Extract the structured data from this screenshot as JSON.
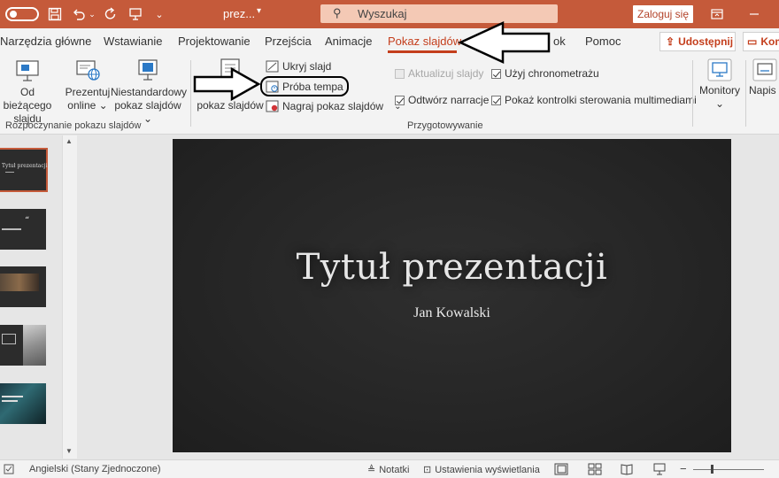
{
  "titlebar": {
    "document_name": "prez...",
    "search_placeholder": "Wyszukaj",
    "signin_label": "Zaloguj się"
  },
  "tabs": [
    {
      "label": "Narzędzia główne"
    },
    {
      "label": "Wstawianie"
    },
    {
      "label": "Projektowanie"
    },
    {
      "label": "Przejścia"
    },
    {
      "label": "Animacje"
    },
    {
      "label": "Pokaz slajdów",
      "active": true
    },
    {
      "label": "ok"
    },
    {
      "label": "Pomoc"
    }
  ],
  "share": {
    "label": "Udostępnij"
  },
  "comments": {
    "label": "Kom"
  },
  "ribbon": {
    "start_group": {
      "from_current": [
        "Od bieżącego",
        "slajdu"
      ],
      "online": [
        "Prezentuj",
        "online"
      ],
      "custom": [
        "Niestandardowy",
        "pokaz slajdów"
      ],
      "label": "Rozpoczynanie pokazu slajdów"
    },
    "setup_group": {
      "setup_show": "pokaz slajdów",
      "hide_slide": "Ukryj slajd",
      "rehearse": "Próba tempa",
      "record": "Nagraj pokaz slajdów",
      "update_slides": "Aktualizuj slajdy",
      "play_narrations": "Odtwórz narracje",
      "use_timings": "Użyj chronometrażu",
      "show_media_controls": "Pokaż kontrolki sterowania multimediami",
      "label": "Przygotowywanie"
    },
    "monitors": {
      "label": "Monitory"
    },
    "captions": {
      "label": "Napis"
    }
  },
  "slide": {
    "title": "Tytuł prezentacji",
    "subtitle": "Jan Kowalski"
  },
  "thumbnails": [
    {
      "text": "Tytuł prezentacji"
    },
    {
      "text": "Cytat"
    },
    {
      "text": ""
    },
    {
      "text": ""
    },
    {
      "text": ""
    }
  ],
  "statusbar": {
    "language": "Angielski (Stany Zjednoczone)",
    "notes": "Notatki",
    "display_settings": "Ustawienia wyświetlania"
  },
  "colors": {
    "accent": "#c55a3a",
    "tab_active": "#c43e1c",
    "slide_bg": "#262626"
  }
}
